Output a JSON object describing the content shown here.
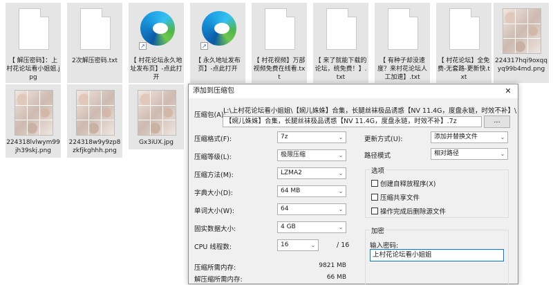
{
  "files": [
    {
      "name": "【 解压密码】：上村花论坛看小姐姐.jpg",
      "icon": "document-icon"
    },
    {
      "name": "2次解压密码.txt",
      "icon": "document-icon"
    },
    {
      "name": "【 村花论坛永久地址发布页】-点此打开",
      "icon": "edge-shortcut-icon"
    },
    {
      "name": "【 永久地址发布页】-点此打开",
      "icon": "edge-shortcut-icon"
    },
    {
      "name": "【 村花视频】万部视频免费在线看.txt",
      "icon": "document-icon"
    },
    {
      "name": "【 来了就能下载的论坛，统免费！】.txt",
      "icon": "document-icon"
    },
    {
      "name": "【 有种子却没速度？来村花论坛人工加速】.txt",
      "icon": "document-icon"
    },
    {
      "name": "【 村花论坛】全免费-无套路-更新快.txt",
      "icon": "document-icon"
    },
    {
      "name": "224317hqi9oxqqyq99b4md.png",
      "icon": "image-thumbnail"
    },
    {
      "name": "224318lvlwym99jh39skj.png",
      "icon": "image-thumbnail"
    },
    {
      "name": "224318w9y9zp8zkfjkghhh.png",
      "icon": "image-thumbnail"
    },
    {
      "name": "Gx3iUX.jpg",
      "icon": "image-thumbnail"
    }
  ],
  "dialog": {
    "title": "添加到压缩包",
    "close": "✕",
    "archive_label": "压缩包(A):",
    "archive_path_line": "L:\\上村花论坛看小姐姐\\【婉儿姝姝】合集，长腿丝袜极品诱惑【NV 11.4G，度盘永链，时效不补】\\",
    "archive_name": "【婉儿姝姝】合集，长腿丝袜极品诱惑【NV 11.4G，度盘永链，时效不补】.7z",
    "browse": "...",
    "format_label": "压缩格式(F):",
    "format_value": "7z",
    "level_label": "压缩等级(L):",
    "level_value": "极限压缩",
    "method_label": "压缩方法(M):",
    "method_value": "LZMA2",
    "dict_label": "字典大小(D):",
    "dict_value": "64 MB",
    "word_label": "单词大小(W):",
    "word_value": "64",
    "solid_label": "固实数据大小:",
    "solid_value": "4 GB",
    "cpu_label": "CPU 线程数:",
    "cpu_value": "16",
    "cpu_total": "/ 16",
    "mem_compress_label": "压缩所需内存:",
    "mem_compress_value": "9821 MB",
    "mem_decompress_label": "解压缩所需内存:",
    "mem_decompress_value": "66 MB",
    "update_label": "更新方式(U):",
    "update_value": "添加并替换文件",
    "pathmode_label": "路径模式",
    "pathmode_value": "相对路径",
    "options_title": "选项",
    "opt_sfx": "创建自释放程序(X)",
    "opt_shared": "压缩共享文件",
    "opt_delete": "操作完成后删除源文件",
    "encrypt_title": "加密",
    "password_label": "输入密码:",
    "password_value": "上村花论坛看小姐姐"
  }
}
